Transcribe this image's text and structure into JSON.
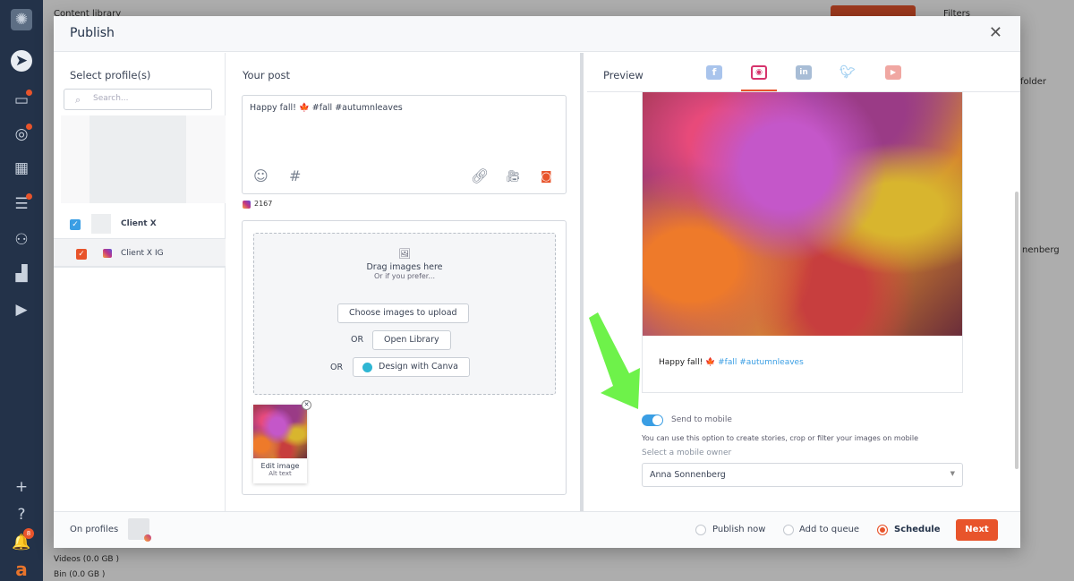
{
  "background": {
    "title": "Content library",
    "right_panel_title": "Filters",
    "folder_text": "folder",
    "name_fragment": "nenberg",
    "storage": [
      "Videos (0.0 GB )",
      "Bin (0.0 GB )"
    ],
    "notification_count": "8"
  },
  "modal": {
    "title": "Publish",
    "profiles": {
      "heading": "Select profile(s)",
      "search_placeholder": "Search...",
      "items": [
        {
          "name": "Client X",
          "checked": true
        },
        {
          "name": "Client X IG",
          "checked": true
        }
      ]
    },
    "post": {
      "heading": "Your post",
      "text": "Happy fall! 🍁 #fall #autumnleaves",
      "char_count": "2167",
      "dropzone": {
        "title": "Drag images here",
        "subtitle": "Or if you prefer...",
        "choose_button": "Choose images to upload",
        "or1": "OR",
        "library_button": "Open Library",
        "or2": "OR",
        "canva_button": "Design with Canva"
      },
      "thumbnail": {
        "edit_label": "Edit image",
        "alt_label": "Alt text"
      }
    },
    "preview": {
      "heading": "Preview",
      "tabs": [
        "facebook",
        "instagram",
        "linkedin",
        "twitter",
        "youtube"
      ],
      "active_tab": "instagram",
      "caption_plain": "Happy fall! 🍁 ",
      "caption_tags": "#fall #autumnleaves",
      "send_to_mobile": {
        "label": "Send to mobile",
        "enabled": true,
        "help": "You can use this option to create stories, crop or filter your images on mobile",
        "owner_label": "Select a mobile owner",
        "owner_value": "Anna Sonnenberg"
      }
    },
    "footer": {
      "on_profiles": "On profiles",
      "options": [
        "Publish now",
        "Add to queue",
        "Schedule"
      ],
      "selected": "Schedule",
      "next": "Next"
    }
  },
  "colors": {
    "accent": "#e8542b",
    "toggle": "#3a9ee4",
    "annotation_arrow": "#6ef24a"
  }
}
